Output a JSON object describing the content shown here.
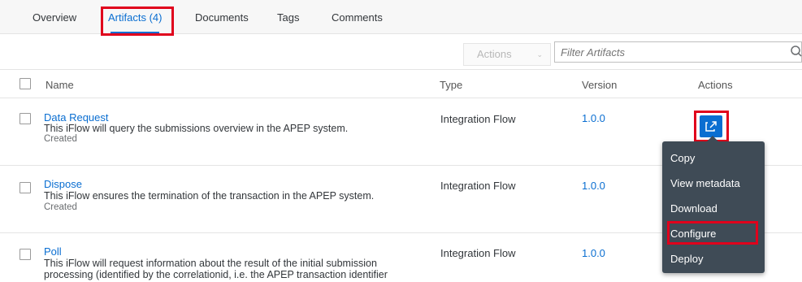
{
  "tabs": [
    {
      "label": "Overview"
    },
    {
      "label": "Artifacts (4)"
    },
    {
      "label": "Documents"
    },
    {
      "label": "Tags"
    },
    {
      "label": "Comments"
    }
  ],
  "toolbar": {
    "actions_label": "Actions",
    "filter_placeholder": "Filter Artifacts"
  },
  "table": {
    "columns": [
      "Name",
      "Type",
      "Version",
      "Actions"
    ],
    "rows": [
      {
        "name": "Data Request",
        "description": [
          "This iFlow will query the submissions overview in the APEP system."
        ],
        "status": "Created",
        "type": "Integration Flow",
        "version": "1.0.0"
      },
      {
        "name": "Dispose",
        "description": [
          "This iFlow ensures the termination of the transaction in the APEP system."
        ],
        "status": "Created",
        "type": "Integration Flow",
        "version": "1.0.0"
      },
      {
        "name": "Poll",
        "description": [
          "This iFlow will request information about the result of the initial submission",
          "processing (identified by the correlationid, i.e. the APEP transaction identifier"
        ],
        "type": "Integration Flow",
        "version": "1.0.0"
      }
    ]
  },
  "action_menu": {
    "items": [
      "Copy",
      "View metadata",
      "Download",
      "Configure",
      "Deploy"
    ],
    "highlighted": "Configure"
  },
  "colors": {
    "accent": "#0a6ed1",
    "highlight_box": "#e0001c",
    "menu_background": "#3f4b56"
  }
}
